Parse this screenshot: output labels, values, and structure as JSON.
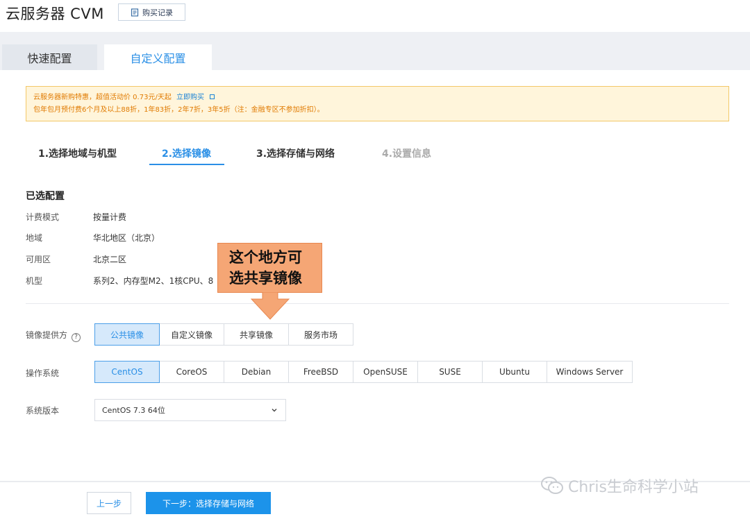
{
  "header": {
    "app_title": "云服务器 CVM",
    "purchase_records": "购买记录",
    "purchase_icon": "receipt-icon"
  },
  "tabs": [
    {
      "label": "快速配置",
      "active": false
    },
    {
      "label": "自定义配置",
      "active": true
    }
  ],
  "promo": {
    "line1_text": "云服务器新购特惠，超值活动价 0.73元/天起",
    "line1_link": "立即购买",
    "line1_icon": "external-link-icon",
    "line2_text": "包年包月预付费6个月及以上88折，1年83折，2年7折，3年5折（注：金融专区不参加折扣）。"
  },
  "steps": [
    {
      "label": "1.选择地域与机型",
      "state": "done"
    },
    {
      "label": "2.选择镜像",
      "state": "active"
    },
    {
      "label": "3.选择存储与网络",
      "state": "normal"
    },
    {
      "label": "4.设置信息",
      "state": "disabled"
    }
  ],
  "selected_config": {
    "title": "已选配置",
    "items": [
      {
        "key": "计费模式",
        "value": "按量计费"
      },
      {
        "key": "地域",
        "value": "华北地区（北京）"
      },
      {
        "key": "可用区",
        "value": "北京二区"
      },
      {
        "key": "机型",
        "value": "系列2、内存型M2、1核CPU、8"
      }
    ]
  },
  "callout": {
    "line1": "这个地方可",
    "line2": "选共享镜像",
    "color": "#f5a675"
  },
  "image_provider": {
    "label": "镜像提供方",
    "help_icon": "question-circle-icon",
    "help_glyph": "?",
    "options": [
      "公共镜像",
      "自定义镜像",
      "共享镜像",
      "服务市场"
    ],
    "selected": "公共镜像"
  },
  "os": {
    "label": "操作系统",
    "options": [
      "CentOS",
      "CoreOS",
      "Debian",
      "FreeBSD",
      "OpenSUSE",
      "SUSE",
      "Ubuntu",
      "Windows Server"
    ],
    "selected": "CentOS"
  },
  "version": {
    "label": "系统版本",
    "value": "CentOS 7.3 64位",
    "icon": "chevron-down-icon"
  },
  "footer": {
    "prev": "上一步",
    "next": "下一步：选择存储与网络"
  },
  "watermark": {
    "text": "Chris生命科学小站",
    "icon": "wechat-icon"
  },
  "colors": {
    "accent": "#2a8fe6",
    "primary_button": "#1c93ea",
    "promo_bg": "#fff5db",
    "promo_text": "#e07a00"
  }
}
